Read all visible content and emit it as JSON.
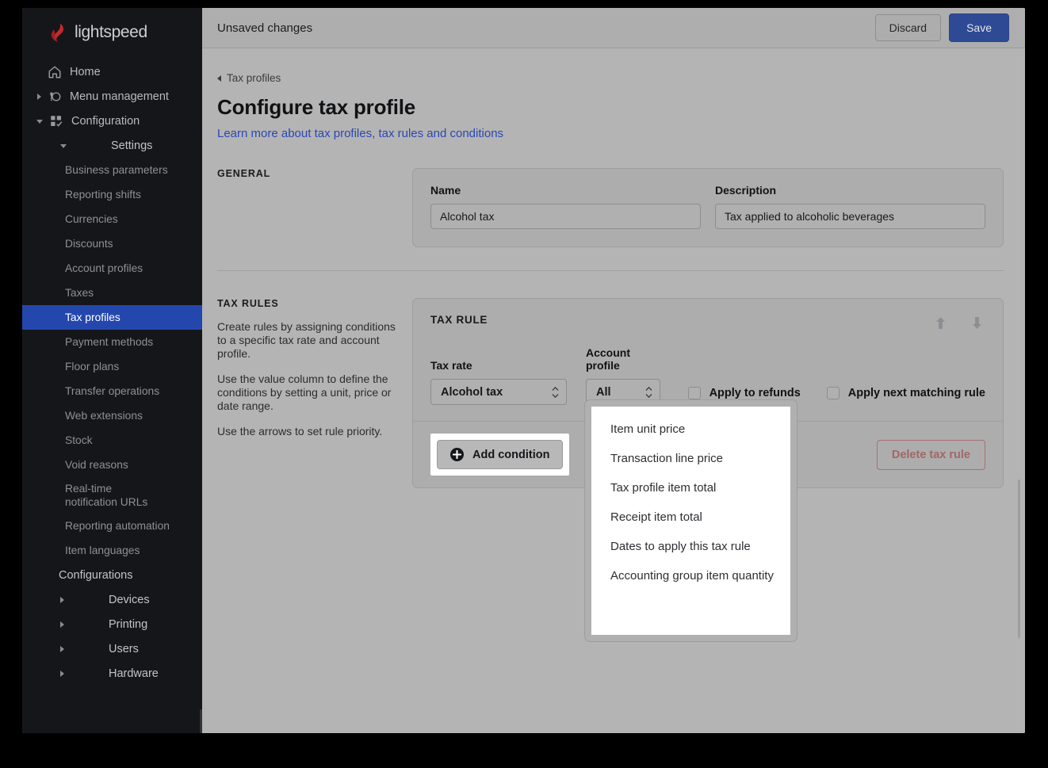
{
  "brand": {
    "name": "lightspeed",
    "logo_color": "#c6282d",
    "text_color": "#cfcfd2"
  },
  "sidebar": {
    "items": [
      {
        "label": "Home",
        "icon": "home-icon",
        "level": 1,
        "caret": "none"
      },
      {
        "label": "Menu management",
        "icon": "menu-management-icon",
        "level": 1,
        "caret": "collapsed"
      },
      {
        "label": "Configuration",
        "icon": "configuration-icon",
        "level": 1,
        "caret": "expanded"
      },
      {
        "label": "Settings",
        "icon": null,
        "level": 2,
        "caret": "expanded"
      },
      {
        "label": "Business parameters",
        "level": 3
      },
      {
        "label": "Reporting shifts",
        "level": 3
      },
      {
        "label": "Currencies",
        "level": 3
      },
      {
        "label": "Discounts",
        "level": 3
      },
      {
        "label": "Account profiles",
        "level": 3
      },
      {
        "label": "Taxes",
        "level": 3
      },
      {
        "label": "Tax profiles",
        "level": 3,
        "active": true
      },
      {
        "label": "Payment methods",
        "level": 3
      },
      {
        "label": "Floor plans",
        "level": 3
      },
      {
        "label": "Transfer operations",
        "level": 3
      },
      {
        "label": "Web extensions",
        "level": 3
      },
      {
        "label": "Stock",
        "level": 3
      },
      {
        "label": "Void reasons",
        "level": 3
      },
      {
        "label": "Real-time notification URLs",
        "level": 3,
        "tall": true
      },
      {
        "label": "Reporting automation",
        "level": 3
      },
      {
        "label": "Item languages",
        "level": 3
      },
      {
        "label": "Configurations",
        "level": 2,
        "caret": "none"
      },
      {
        "label": "Devices",
        "level": 2,
        "caret": "collapsed"
      },
      {
        "label": "Printing",
        "level": 2,
        "caret": "collapsed"
      },
      {
        "label": "Users",
        "level": 2,
        "caret": "collapsed"
      },
      {
        "label": "Hardware",
        "level": 2,
        "caret": "collapsed"
      }
    ],
    "active_label": "Tax profiles",
    "active_color": "#2447ae"
  },
  "topbar": {
    "status_text": "Unsaved changes",
    "discard_label": "Discard",
    "save_label": "Save",
    "save_color": "#2f4a95"
  },
  "header": {
    "breadcrumb": "Tax profiles",
    "back_icon": "chevron-left-icon",
    "title": "Configure tax profile",
    "link": "Learn more about tax profiles, tax rules and conditions",
    "link_color": "#2b47b4"
  },
  "general": {
    "section_title": "GENERAL",
    "name_label": "Name",
    "name_value": "Alcohol tax",
    "description_label": "Description",
    "description_value": "Tax applied to alcoholic beverages"
  },
  "tax_rules": {
    "section_title": "TAX RULES",
    "desc1": "Create rules by assigning conditions to a specific tax rate and account profile.",
    "desc2": "Use the value column to define the conditions by setting a unit, price or date range.",
    "desc3": "Use the arrows to set rule priority.",
    "card_title": "TAX RULE",
    "move_up_icon": "arrow-up-icon",
    "move_down_icon": "arrow-down-icon",
    "tax_rate_label": "Tax rate",
    "tax_rate_value": "Alcohol tax",
    "account_profile_label": "Account profile",
    "account_profile_value": "All",
    "apply_refunds_label": "Apply to refunds",
    "apply_refunds_checked": false,
    "apply_next_label": "Apply next matching rule",
    "apply_next_checked": false,
    "add_condition_label": "Add condition",
    "add_condition_icon": "plus-circle-icon",
    "delete_label": "Delete tax rule",
    "delete_color": "#a06867"
  },
  "dropdown": {
    "open": true,
    "items": [
      "Item unit price",
      "Transaction line price",
      "Tax profile item total",
      "Receipt item total",
      "Dates to apply this tax rule",
      "Accounting group item quantity"
    ]
  }
}
